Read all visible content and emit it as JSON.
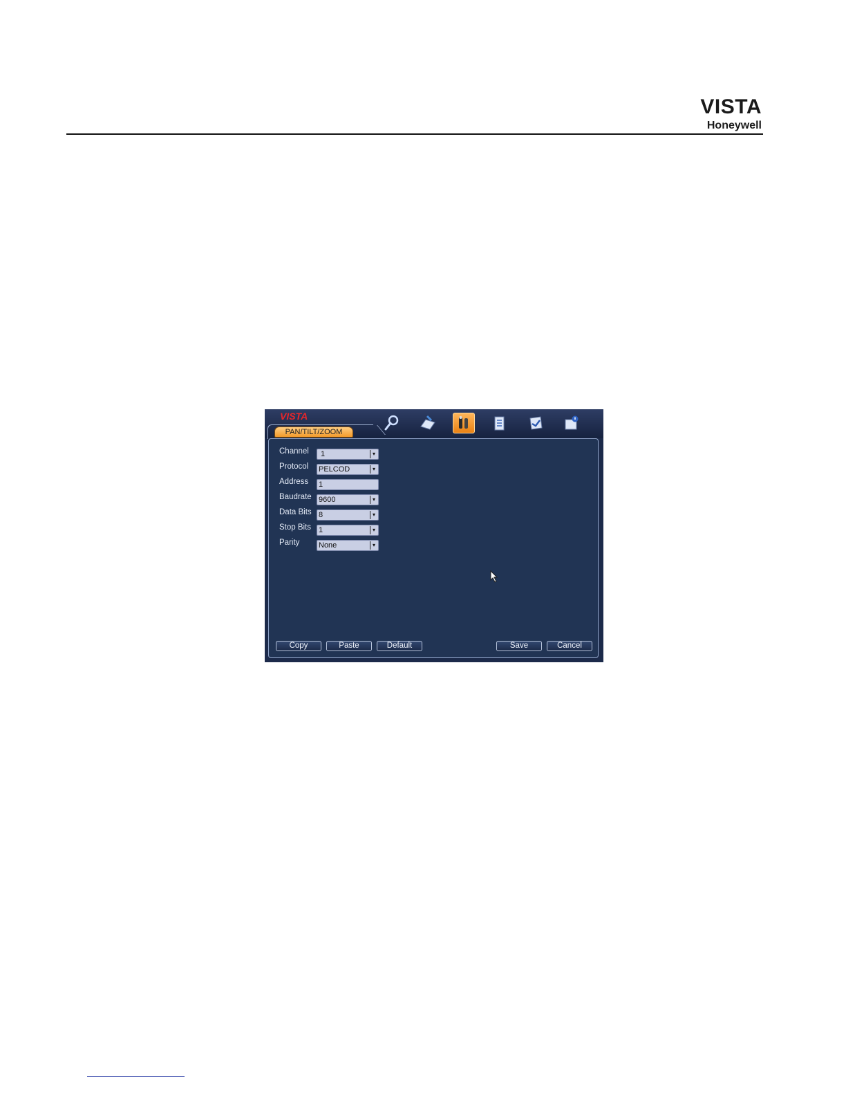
{
  "page": {
    "brand_title": "VISTA",
    "brand_subtitle": "Honeywell"
  },
  "dvr": {
    "app_logo": "VISTA",
    "active_tab": "PAN/TILT/ZOOM",
    "toolbar_icons": [
      "search-icon",
      "record-icon",
      "ptz-settings-icon",
      "info-icon",
      "advanced-icon",
      "shutdown-icon"
    ],
    "form": {
      "channel": {
        "label": "Channel",
        "value": "1"
      },
      "protocol": {
        "label": "Protocol",
        "value": "PELCOD"
      },
      "address": {
        "label": "Address",
        "value": "1"
      },
      "baudrate": {
        "label": "Baudrate",
        "value": "9600"
      },
      "data_bits": {
        "label": "Data Bits",
        "value": "8"
      },
      "stop_bits": {
        "label": "Stop Bits",
        "value": "1"
      },
      "parity": {
        "label": "Parity",
        "value": "None"
      }
    },
    "buttons": {
      "copy": "Copy",
      "paste": "Paste",
      "default": "Default",
      "save": "Save",
      "cancel": "Cancel"
    },
    "colors": {
      "accent": "#f39a2a",
      "logo_red": "#e8262a",
      "panel_bg": "#213454"
    }
  }
}
